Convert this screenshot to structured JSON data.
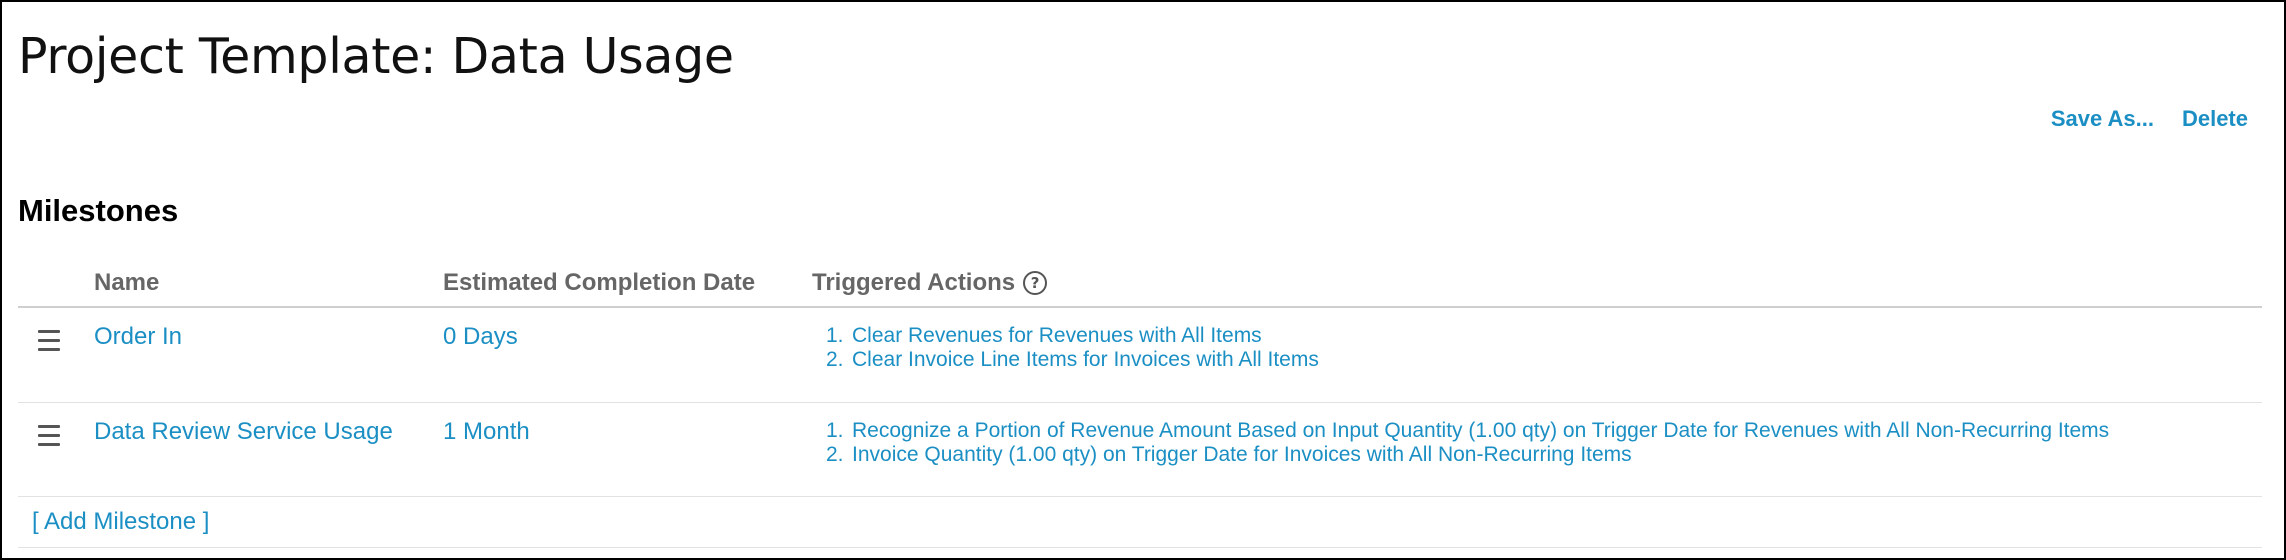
{
  "page": {
    "title": "Project Template: Data Usage"
  },
  "toolbar": {
    "save_as_label": "Save As...",
    "delete_label": "Delete"
  },
  "milestones": {
    "section_title": "Milestones",
    "columns": {
      "name": "Name",
      "date": "Estimated Completion Date",
      "actions": "Triggered Actions"
    },
    "help_icon_glyph": "?",
    "rows": [
      {
        "name": "Order In",
        "date": "0 Days",
        "actions": [
          {
            "num": "1.",
            "text": "Clear Revenues for Revenues with All Items"
          },
          {
            "num": "2.",
            "text": "Clear Invoice Line Items for Invoices with All Items"
          }
        ]
      },
      {
        "name": "Data Review Service Usage",
        "date": "1 Month",
        "actions": [
          {
            "num": "1.",
            "text": "Recognize a Portion of Revenue Amount Based on Input Quantity (1.00 qty) on Trigger Date for Revenues with All Non-Recurring Items"
          },
          {
            "num": "2.",
            "text": "Invoice Quantity (1.00 qty) on Trigger Date for Invoices with All Non-Recurring Items"
          }
        ]
      }
    ],
    "add_label": "[ Add Milestone ]"
  },
  "colors": {
    "link": "#1b8fc4",
    "header_text": "#666666",
    "border": "#cfcfcf"
  },
  "icons": {
    "drag_handle": "hamburger-drag-icon",
    "help": "question-circle-icon"
  }
}
